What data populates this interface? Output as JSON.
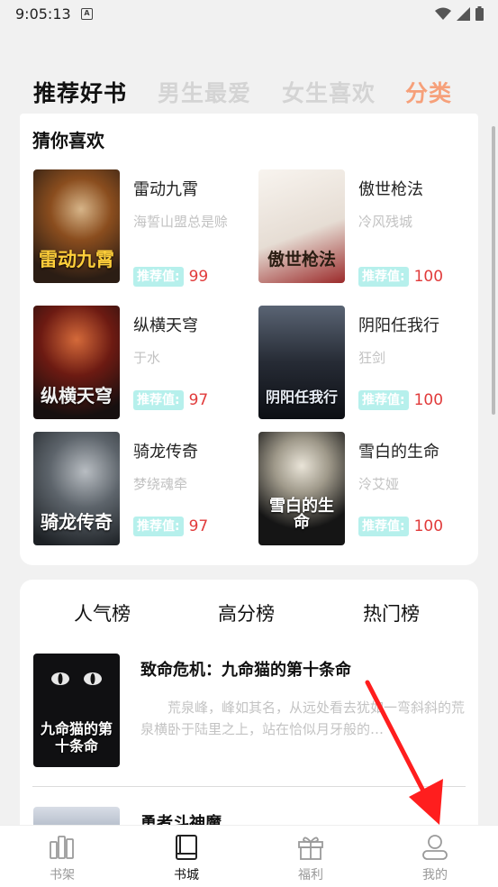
{
  "status_bar": {
    "time": "9:05:13",
    "notif_glyph": "A"
  },
  "top_tabs": [
    {
      "label": "推荐好书",
      "state": "active"
    },
    {
      "label": "男生最爱",
      "state": "inactive"
    },
    {
      "label": "女生喜欢",
      "state": "inactive"
    },
    {
      "label": "分类",
      "state": "accent"
    }
  ],
  "guess": {
    "title": "猜你喜欢",
    "rec_label": "推荐值:",
    "books": [
      {
        "name": "雷动九霄",
        "author": "海誓山盟总是赊",
        "score": "99",
        "cover_text": "雷动九霄",
        "cover_colors": [
          "#3a2a1a",
          "#b8611e"
        ]
      },
      {
        "name": "傲世枪法",
        "author": "冷风残城",
        "score": "100",
        "cover_text": "傲世枪法",
        "cover_colors": [
          "#f2ece6",
          "#8a1c1c"
        ]
      },
      {
        "name": "纵横天穹",
        "author": "于水",
        "score": "97",
        "cover_text": "纵横天穹",
        "cover_colors": [
          "#1e1414",
          "#7a1b12"
        ]
      },
      {
        "name": "阴阳任我行",
        "author": "狂剑",
        "score": "100",
        "cover_text": "阴阳任我行",
        "cover_colors": [
          "#3a4250",
          "#0f1218"
        ]
      },
      {
        "name": "骑龙传奇",
        "author": "梦绕魂牵",
        "score": "97",
        "cover_text": "骑龙传奇",
        "cover_colors": [
          "#2c3238",
          "#8e9499"
        ]
      },
      {
        "name": "雪白的生命",
        "author": "泠艾娅",
        "score": "100",
        "cover_text": "雪白的生命",
        "cover_colors": [
          "#c6c2b6",
          "#0d0d0d"
        ]
      }
    ]
  },
  "rank": {
    "tabs": [
      "人气榜",
      "高分榜",
      "热门榜"
    ],
    "item1": {
      "title": "致命危机：九命猫的第十条命",
      "desc": "荒泉峰，峰如其名，从远处看去犹如一弯斜斜的荒泉横卧于陆里之上，站在恰似月牙般的…",
      "cover_text": "九命猫的第十条命"
    },
    "item2": {
      "title": "勇者斗神魔"
    }
  },
  "bottom_nav": [
    {
      "label": "书架",
      "icon": "bookshelf-icon",
      "active": false
    },
    {
      "label": "书城",
      "icon": "book-icon",
      "active": true
    },
    {
      "label": "福利",
      "icon": "gift-icon",
      "active": false
    },
    {
      "label": "我的",
      "icon": "profile-icon",
      "active": false
    }
  ],
  "colors": {
    "accent": "#f6a07a",
    "score": "#e13b3b",
    "rec_badge": "#b6f0ec",
    "arrow": "#ff1e1e"
  }
}
